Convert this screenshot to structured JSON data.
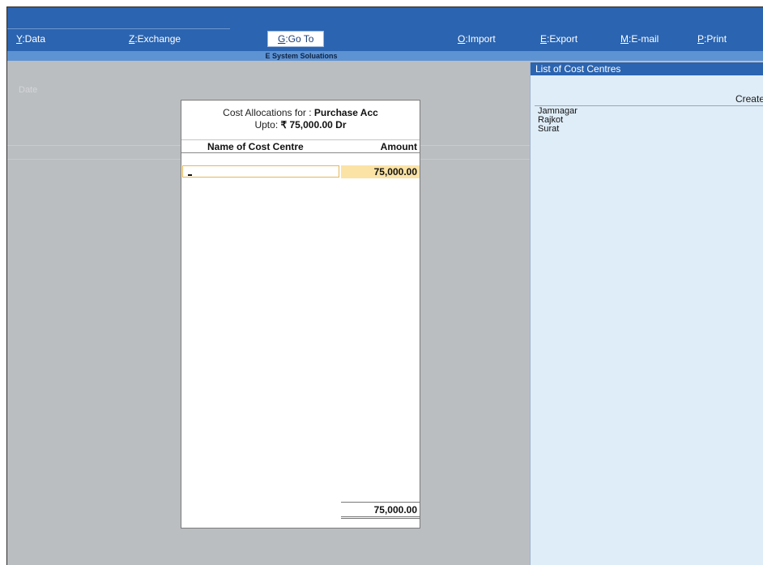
{
  "menu": {
    "data": {
      "key": "Y",
      "label": ":Data"
    },
    "exchange": {
      "key": "Z",
      "label": ":Exchange"
    },
    "goto": {
      "key": "G",
      "label": ":Go To"
    },
    "import": {
      "key": "O",
      "label": ":Import"
    },
    "export": {
      "key": "E",
      "label": ":Export"
    },
    "email": {
      "key": "M",
      "label": ":E-mail"
    },
    "print": {
      "key": "P",
      "label": ":Print"
    }
  },
  "company_name": "E System Soluations",
  "background": {
    "date_label": "Date"
  },
  "dialog": {
    "title_prefix": "Cost Allocations for : ",
    "ledger_name": "Purchase Acc",
    "upto_label": "Upto: ",
    "upto_amount": "₹ 75,000.00 Dr",
    "col_name": "Name of Cost Centre",
    "col_amount": "Amount",
    "row_amount": "75,000.00",
    "total": "75,000.00"
  },
  "panel": {
    "title": "List of Cost Centres",
    "create_label": "Create",
    "items": [
      "Jamnagar",
      "Rajkot",
      "Surat"
    ]
  },
  "colors": {
    "accent": "#2b64b0",
    "strip": "#5e93d3",
    "highlight": "#fbe3a6"
  }
}
